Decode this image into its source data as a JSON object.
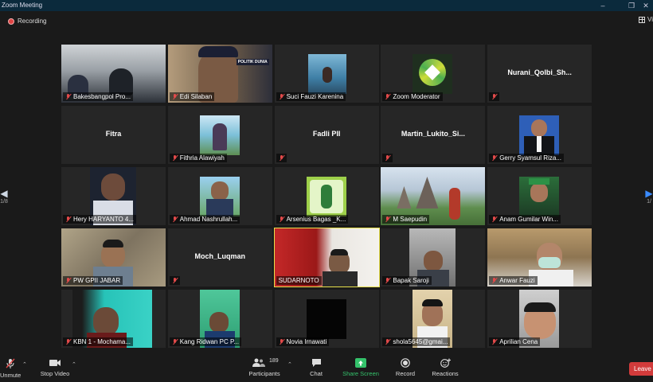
{
  "window": {
    "title": "Zoom Meeting"
  },
  "recording": {
    "label": "Recording"
  },
  "view": {
    "label": "Vi"
  },
  "pager": {
    "left": "1/8",
    "right": "1/"
  },
  "participants": [
    {
      "name": "Bakesbangpol Pro...",
      "muted": true,
      "video": true,
      "scene": "office"
    },
    {
      "name": "Edi Silaban",
      "muted": true,
      "video": true,
      "scene": "person-banner",
      "overlay": "POLITIK DUNIA"
    },
    {
      "name": "Suci Fauzi Karenina",
      "muted": true,
      "video": true,
      "scene": "photo-sea"
    },
    {
      "name": "Zoom Moderator",
      "muted": true,
      "video": true,
      "scene": "logo-star"
    },
    {
      "name": "Nurani_Qolbi_Sh...",
      "muted": true,
      "video": false
    },
    {
      "name": "Fitra",
      "muted": false,
      "video": false
    },
    {
      "name": "Fithria Alawiyah",
      "muted": true,
      "video": true,
      "scene": "photo-beach"
    },
    {
      "name": "Fadli PII",
      "muted": true,
      "video": false
    },
    {
      "name": "Martin_Lukito_Si...",
      "muted": true,
      "video": false
    },
    {
      "name": "Gerry Syamsul Riza...",
      "muted": true,
      "video": true,
      "scene": "photo-suit"
    },
    {
      "name": "Hery HARYANTO 4...",
      "muted": true,
      "video": true,
      "scene": "person-dark"
    },
    {
      "name": "Ahmad Nashrullah...",
      "muted": true,
      "video": true,
      "scene": "photo-outdoor"
    },
    {
      "name": "Arsenius Bagas _K...",
      "muted": true,
      "video": true,
      "scene": "photo-green"
    },
    {
      "name": "M Saepudin",
      "muted": true,
      "video": true,
      "scene": "temple"
    },
    {
      "name": "Anam Gumilar Win...",
      "muted": true,
      "video": true,
      "scene": "photo-hat"
    },
    {
      "name": "PW GPII JABAR",
      "muted": true,
      "video": true,
      "scene": "person-wall"
    },
    {
      "name": "Moch_Luqman",
      "muted": true,
      "video": false
    },
    {
      "name": "SUDARNOTO",
      "muted": false,
      "video": true,
      "scene": "person-red",
      "active": true
    },
    {
      "name": "Bapak Saroji",
      "muted": true,
      "video": true,
      "scene": "person-room"
    },
    {
      "name": "Anwar Fauzi",
      "muted": true,
      "video": true,
      "scene": "person-mask"
    },
    {
      "name": "KBN 1 - Mochama...",
      "muted": true,
      "video": true,
      "scene": "person-teal"
    },
    {
      "name": "Kang Ridwan PC P...",
      "muted": true,
      "video": true,
      "scene": "person-green"
    },
    {
      "name": "Novia Irnawati",
      "muted": true,
      "video": true,
      "scene": "black"
    },
    {
      "name": "shola5645@gmai...",
      "muted": true,
      "video": true,
      "scene": "person-cap"
    },
    {
      "name": "Aprilian Cena",
      "muted": true,
      "video": true,
      "scene": "person-close"
    }
  ],
  "toolbar": {
    "unmute": "Unmute",
    "stop_video": "Stop Video",
    "participants": "Participants",
    "participants_count": "189",
    "chat": "Chat",
    "share_screen": "Share Screen",
    "record": "Record",
    "reactions": "Reactions",
    "leave": "Leave"
  },
  "colors": {
    "background": "#1a1a1a",
    "tile": "#262626",
    "active_speaker": "#e8e04c",
    "muted": "#e24a4a",
    "share": "#34c26b",
    "leave": "#d23b3b"
  }
}
